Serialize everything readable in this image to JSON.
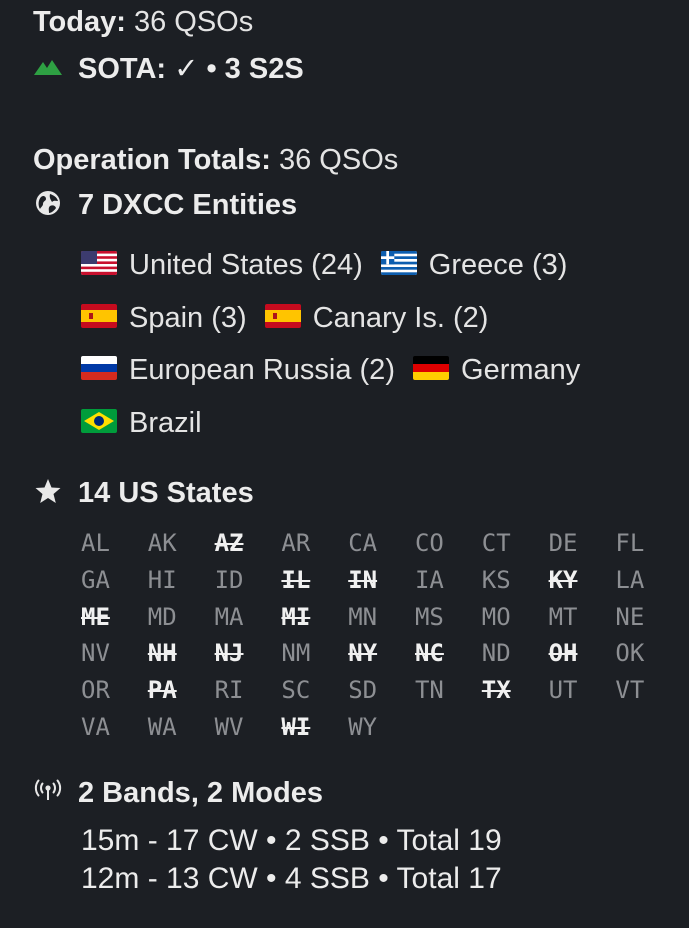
{
  "today": {
    "label": "Today:",
    "value": "36 QSOs"
  },
  "sota": {
    "icon": "mountain-icon",
    "icon_color": "#2ea043",
    "text": "SOTA: ✓ • 3 S2S"
  },
  "totals": {
    "label": "Operation Totals:",
    "value": "36 QSOs"
  },
  "dxcc": {
    "icon": "globe-icon",
    "heading": "7 DXCC Entities",
    "lines": [
      [
        {
          "flag": "us-flag",
          "text": "United States (24)"
        },
        {
          "flag": "greece-flag",
          "text": "Greece (3)"
        }
      ],
      [
        {
          "flag": "spain-flag",
          "text": "Spain (3)"
        },
        {
          "flag": "spain-flag",
          "text": "Canary Is. (2)"
        }
      ],
      [
        {
          "flag": "russia-flag",
          "text": "European Russia (2)"
        },
        {
          "flag": "germany-flag",
          "text": "Germany"
        }
      ],
      [
        {
          "flag": "brazil-flag",
          "text": "Brazil"
        }
      ]
    ]
  },
  "us_states": {
    "icon": "star-icon",
    "heading": "14 US States",
    "rows": [
      [
        {
          "code": "AL",
          "worked": false
        },
        {
          "code": "AK",
          "worked": false
        },
        {
          "code": "AZ",
          "worked": true
        },
        {
          "code": "AR",
          "worked": false
        },
        {
          "code": "CA",
          "worked": false
        },
        {
          "code": "CO",
          "worked": false
        },
        {
          "code": "CT",
          "worked": false
        },
        {
          "code": "DE",
          "worked": false
        },
        {
          "code": "FL",
          "worked": false
        }
      ],
      [
        {
          "code": "GA",
          "worked": false
        },
        {
          "code": "HI",
          "worked": false
        },
        {
          "code": "ID",
          "worked": false
        },
        {
          "code": "IL",
          "worked": true
        },
        {
          "code": "IN",
          "worked": true
        },
        {
          "code": "IA",
          "worked": false
        },
        {
          "code": "KS",
          "worked": false
        },
        {
          "code": "KY",
          "worked": true
        },
        {
          "code": "LA",
          "worked": false
        }
      ],
      [
        {
          "code": "ME",
          "worked": true
        },
        {
          "code": "MD",
          "worked": false
        },
        {
          "code": "MA",
          "worked": false
        },
        {
          "code": "MI",
          "worked": true
        },
        {
          "code": "MN",
          "worked": false
        },
        {
          "code": "MS",
          "worked": false
        },
        {
          "code": "MO",
          "worked": false
        },
        {
          "code": "MT",
          "worked": false
        },
        {
          "code": "NE",
          "worked": false
        }
      ],
      [
        {
          "code": "NV",
          "worked": false
        },
        {
          "code": "NH",
          "worked": true
        },
        {
          "code": "NJ",
          "worked": true
        },
        {
          "code": "NM",
          "worked": false
        },
        {
          "code": "NY",
          "worked": true
        },
        {
          "code": "NC",
          "worked": true
        },
        {
          "code": "ND",
          "worked": false
        },
        {
          "code": "OH",
          "worked": true
        },
        {
          "code": "OK",
          "worked": false
        }
      ],
      [
        {
          "code": "OR",
          "worked": false
        },
        {
          "code": "PA",
          "worked": true
        },
        {
          "code": "RI",
          "worked": false
        },
        {
          "code": "SC",
          "worked": false
        },
        {
          "code": "SD",
          "worked": false
        },
        {
          "code": "TN",
          "worked": false
        },
        {
          "code": "TX",
          "worked": true
        },
        {
          "code": "UT",
          "worked": false
        },
        {
          "code": "VT",
          "worked": false
        }
      ],
      [
        {
          "code": "VA",
          "worked": false
        },
        {
          "code": "WA",
          "worked": false
        },
        {
          "code": "WV",
          "worked": false
        },
        {
          "code": "WI",
          "worked": true
        },
        {
          "code": "WY",
          "worked": false
        }
      ]
    ]
  },
  "bands": {
    "icon": "antenna-icon",
    "heading": "2 Bands, 2 Modes",
    "lines": [
      "15m -  17 CW • 2 SSB • Total 19",
      "12m -  13 CW • 4 SSB • Total 17"
    ]
  }
}
